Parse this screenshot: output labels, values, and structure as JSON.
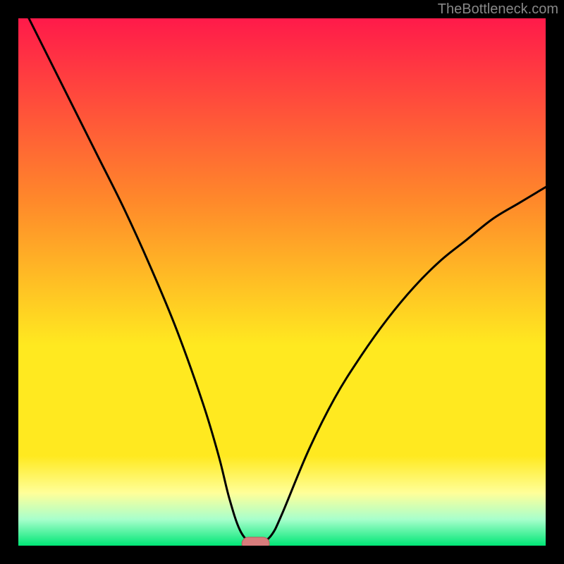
{
  "watermark": "TheBottleneck.com",
  "colors": {
    "bg": "#000000",
    "grad_top": "#ff1a4a",
    "grad_upper_mid": "#ff8a2a",
    "grad_mid": "#ffe920",
    "grad_lower_mid": "#ffff99",
    "grad_lower": "#a8ffcc",
    "grad_bottom": "#00e676",
    "curve": "#000000",
    "marker_fill": "#d87c7c",
    "marker_stroke": "#b85c5c"
  },
  "chart_data": {
    "type": "line",
    "title": "",
    "xlabel": "",
    "ylabel": "",
    "xlim": [
      0,
      100
    ],
    "ylim": [
      0,
      100
    ],
    "series": [
      {
        "name": "bottleneck-curve",
        "x": [
          2,
          5,
          10,
          15,
          20,
          25,
          30,
          35,
          38,
          40,
          42,
          44,
          45,
          46,
          48,
          50,
          55,
          60,
          65,
          70,
          75,
          80,
          85,
          90,
          95,
          100
        ],
        "y": [
          100,
          94,
          84,
          74,
          64,
          53,
          41,
          27,
          17,
          9,
          3,
          0.5,
          0.5,
          0.5,
          2,
          6,
          18,
          28,
          36,
          43,
          49,
          54,
          58,
          62,
          65,
          68
        ]
      }
    ],
    "marker": {
      "x": 45,
      "y": 0.4,
      "rx": 2.6,
      "ry": 1.2
    },
    "annotations": []
  }
}
